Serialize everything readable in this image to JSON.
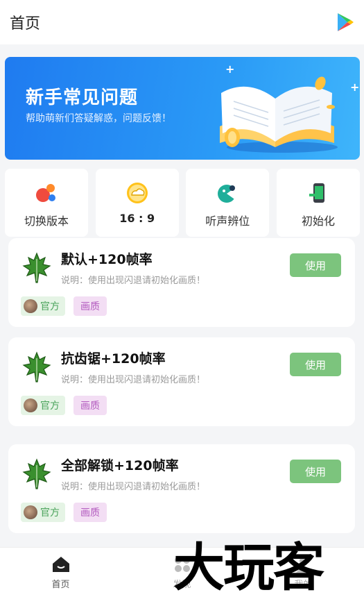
{
  "header": {
    "title": "首页",
    "play_icon": "google-play-icon"
  },
  "banner": {
    "title": "新手常见问题",
    "subtitle": "帮助萌新们答疑解惑，问题反馈！",
    "bg_color": "#1f7bf0"
  },
  "quick_actions": [
    {
      "label": "切换版本",
      "icon": "switch-version-icon"
    },
    {
      "label": "16 : 9",
      "icon": "aspect-ratio-icon"
    },
    {
      "label": "听声辨位",
      "icon": "sound-locate-icon"
    },
    {
      "label": "初始化",
      "icon": "initialize-icon"
    }
  ],
  "cards": [
    {
      "title": "默认+120帧率",
      "desc": "说明：使用出现闪退请初始化画质！",
      "button": "使用",
      "tag_official": "官方",
      "tag_quality": "画质"
    },
    {
      "title": "抗齿锯+120帧率",
      "desc": "说明：使用出现闪退请初始化画质！",
      "button": "使用",
      "tag_official": "官方",
      "tag_quality": "画质"
    },
    {
      "title": "全部解锁+120帧率",
      "desc": "说明：使用出现闪退请初始化画质！",
      "button": "使用",
      "tag_official": "官方",
      "tag_quality": "画质"
    }
  ],
  "bottom_nav": [
    {
      "label": "首页",
      "icon": "home-icon",
      "active": true
    },
    {
      "label": "发现",
      "icon": "discover-icon",
      "active": false
    },
    {
      "label": "我的",
      "icon": "profile-icon",
      "active": false
    }
  ],
  "watermark": "大玩客",
  "colors": {
    "accent_green": "#7cc47d",
    "tag_green": "#4aa35b",
    "tag_purple": "#b35bbf"
  }
}
